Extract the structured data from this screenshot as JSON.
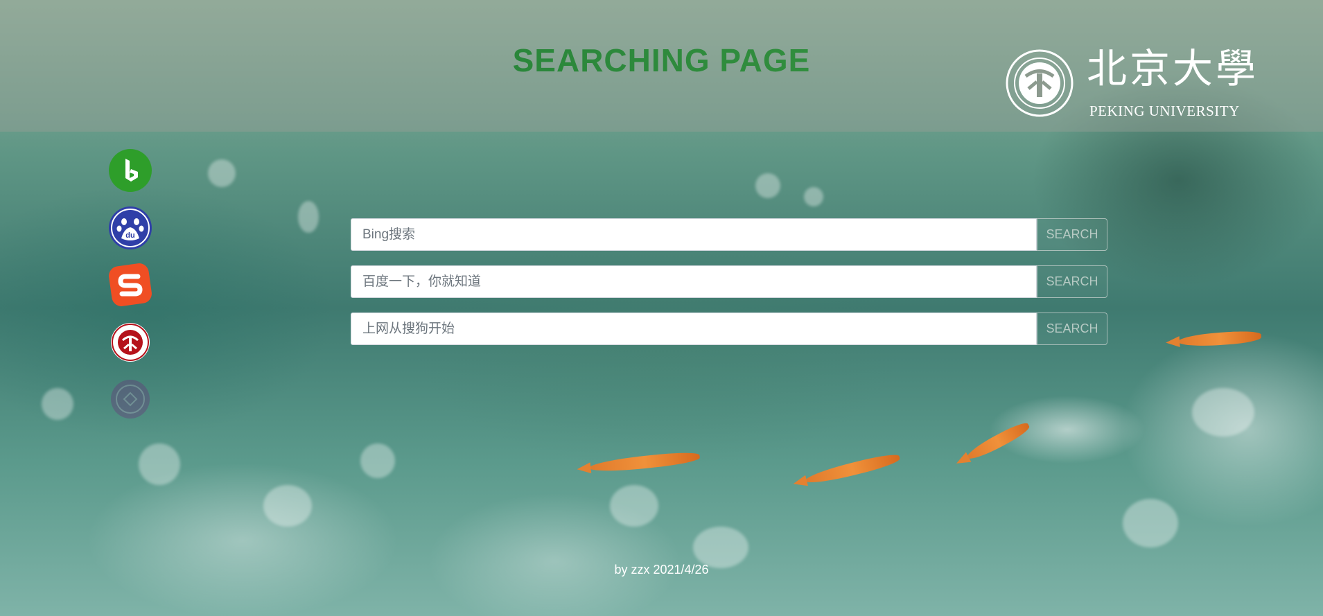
{
  "header": {
    "title": "SEARCHING PAGE",
    "logo_cn": "北京大學",
    "logo_en": "PEKING UNIVERSITY"
  },
  "sidebar": {
    "icons": [
      {
        "name": "bing-icon",
        "color": "#2e9e2a"
      },
      {
        "name": "baidu-icon",
        "color": "#2f3fa8"
      },
      {
        "name": "sogou-icon",
        "color": "#f04e23"
      },
      {
        "name": "pku-icon",
        "color": "#b5121b"
      },
      {
        "name": "faded-logo-icon",
        "color": "#6b2d7a"
      }
    ]
  },
  "searches": [
    {
      "placeholder": "Bing搜索",
      "button": "SEARCH"
    },
    {
      "placeholder": "百度一下，你就知道",
      "button": "SEARCH"
    },
    {
      "placeholder": "上网从搜狗开始",
      "button": "SEARCH"
    }
  ],
  "footer": {
    "text": "by zzx 2021/4/26"
  }
}
